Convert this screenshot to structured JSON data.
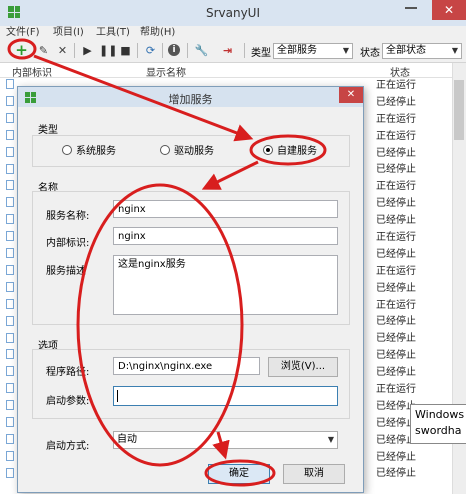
{
  "window": {
    "title": "SrvanyUI",
    "close_glyph": "✕"
  },
  "menu": [
    "文件(F)",
    "项目(I)",
    "工具(T)",
    "帮助(H)"
  ],
  "toolbar": {
    "type_label": "类型",
    "type_value": "全部服务",
    "status_label": "状态",
    "status_value": "全部状态",
    "icons": [
      "add-icon",
      "edit-icon",
      "delete-icon",
      "start-icon",
      "pause-icon",
      "stop-icon",
      "refresh-icon",
      "info-icon",
      "wrench-icon",
      "exit-icon"
    ]
  },
  "list": {
    "columns": [
      "内部标识",
      "显示名称",
      "状态"
    ],
    "statuses": [
      "正在运行",
      "已经停止",
      "正在运行",
      "正在运行",
      "已经停止",
      "已经停止",
      "正在运行",
      "已经停止",
      "已经停止",
      "正在运行",
      "已经停止",
      "正在运行",
      "已经停止",
      "正在运行",
      "已经停止",
      "已经停止",
      "已经停止",
      "已经停止",
      "正在运行",
      "已经停止",
      "已经停止",
      "已经停止",
      "已经停止",
      "已经停止"
    ]
  },
  "tooltip": {
    "line1": "Windows",
    "line2": "swordha"
  },
  "dialog": {
    "title": "增加服务",
    "close_glyph": "✕",
    "type_section": "类型",
    "radios": [
      {
        "label": "系统服务",
        "checked": false
      },
      {
        "label": "驱动服务",
        "checked": false
      },
      {
        "label": "自建服务",
        "checked": true
      }
    ],
    "name_section": "名称",
    "service_name_label": "服务名称:",
    "service_name_value": "nginx",
    "internal_id_label": "内部标识:",
    "internal_id_value": "nginx",
    "description_label": "服务描述",
    "description_value": "这是nginx服务",
    "options_section": "选项",
    "program_path_label": "程序路径:",
    "program_path_value": "D:\\nginx\\nginx.exe",
    "browse_button": "浏览(V)...",
    "startup_args_label": "启动参数:",
    "startup_args_value": "",
    "startup_mode_label": "启动方式:",
    "startup_mode_value": "自动",
    "ok_button": "确定",
    "cancel_button": "取消"
  },
  "colors": {
    "annotation": "#d81e1e",
    "accent_green": "#3a9d3a",
    "close_red": "#c74545"
  }
}
